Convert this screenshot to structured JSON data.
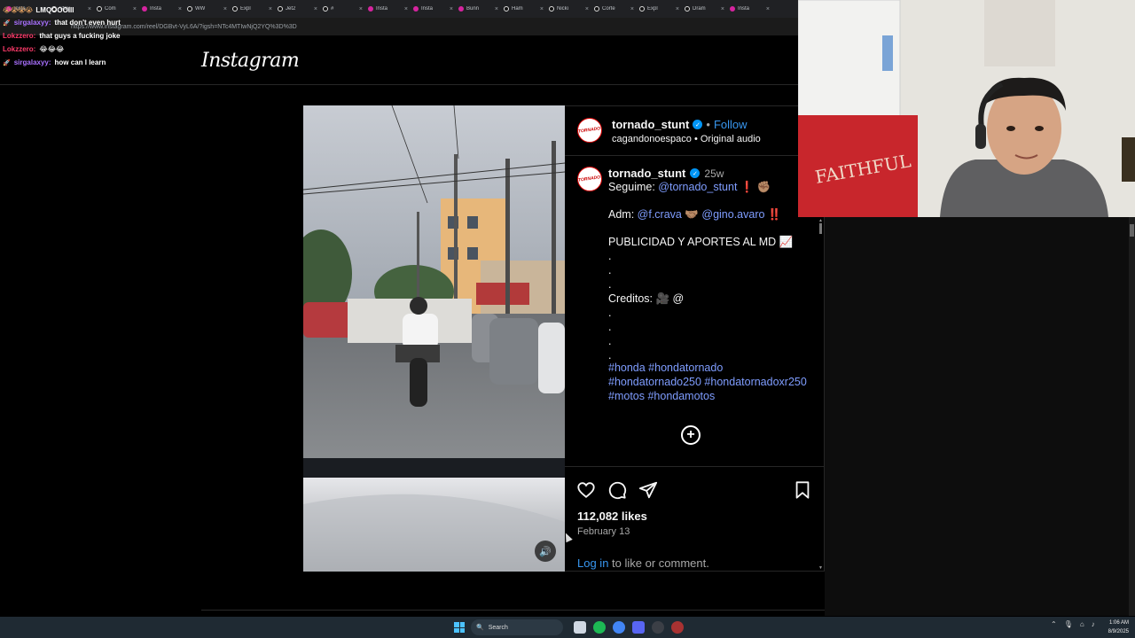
{
  "browser": {
    "tabs": [
      {
        "title": "insta",
        "icon": "instagram-icon"
      },
      {
        "title": "Stay",
        "icon": "tiktok-icon"
      },
      {
        "title": "Cóm",
        "icon": "tiktok-icon"
      },
      {
        "title": "Insta",
        "icon": "instagram-icon"
      },
      {
        "title": "WW",
        "icon": "tiktok-icon"
      },
      {
        "title": "Expl",
        "icon": "tiktok-icon"
      },
      {
        "title": "Jet2",
        "icon": "tiktok-icon"
      },
      {
        "title": "#",
        "icon": "tiktok-icon"
      },
      {
        "title": "Insta",
        "icon": "instagram-icon"
      },
      {
        "title": "Insta",
        "icon": "instagram-icon"
      },
      {
        "title": "Bunn",
        "icon": "instagram-icon"
      },
      {
        "title": "Ham",
        "icon": "tiktok-icon"
      },
      {
        "title": "Nicki",
        "icon": "tiktok-icon"
      },
      {
        "title": "Corte",
        "icon": "tiktok-icon"
      },
      {
        "title": "Expl",
        "icon": "tiktok-icon"
      },
      {
        "title": "Dram",
        "icon": "tiktok-icon"
      },
      {
        "title": "Insta",
        "icon": "instagram-icon"
      }
    ],
    "url": "https://www.instagram.com/reel/DGBvt-VyL6A/?igsh=NTc4MTIwNjQ2YQ%3D%3D"
  },
  "chat": {
    "top_message": "LMQOOOIII",
    "lines": [
      {
        "user": "sirgalaxyy:",
        "message": "that don't even hurt",
        "color": "#a970ff",
        "badge": true
      },
      {
        "user": "Lokzzero:",
        "message": "that guys a fucking joke",
        "color": "#ff3b6b",
        "badge": false
      },
      {
        "user": "Lokzzero:",
        "message": "😂😂😂",
        "color": "#ff3b6b",
        "badge": false
      },
      {
        "user": "sirgalaxyy:",
        "message": "how can I learn",
        "color": "#a970ff",
        "badge": true
      }
    ]
  },
  "instagram": {
    "logo": "Instagram",
    "post": {
      "username": "tornado_stunt",
      "follow_label": "Follow",
      "audio_label": "cagandonoespaco • Original audio",
      "avatar_text": "TORNADO",
      "caption": {
        "username": "tornado_stunt",
        "time": "25w",
        "line1_prefix": "Seguime: ",
        "line1_mention": "@tornado_stunt",
        "line1_suffix": " ❗ ✊🏽",
        "line2_prefix": "Adm: ",
        "line2_mention1": "@f.crava",
        "line2_mid": " 🤝🏽 ",
        "line2_mention2": "@gino.avaro",
        "line2_suffix": " ‼️",
        "line3": "PUBLICIDAD Y APORTES AL MD 📈",
        "dot": ".",
        "creditos": "Creditos: 🎥 @",
        "hashtags1": "#honda #hondatornado",
        "hashtags2": "#hondatornado250 #hondatornadoxr250",
        "hashtags3": "#motos #hondamotos"
      },
      "likes": "112,082 likes",
      "date": "February 13",
      "login_link": "Log in",
      "login_suffix": " to like or comment."
    }
  },
  "taskbar": {
    "search_label": "Search",
    "time": "1:06 AM",
    "date": "8/9/2025"
  }
}
